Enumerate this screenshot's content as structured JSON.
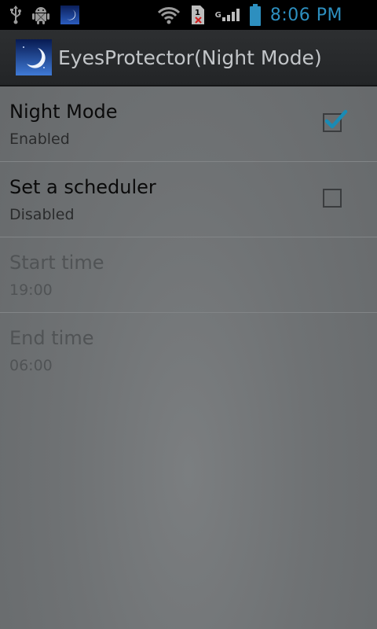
{
  "status_bar": {
    "time": "8:06 PM",
    "network_label": "G",
    "icons": [
      "usb-icon",
      "android-debug-icon",
      "night-mode-notification-icon",
      "wifi-icon",
      "sim-missing-icon",
      "signal-icon",
      "battery-icon"
    ],
    "time_color": "#2d8fbf"
  },
  "action_bar": {
    "title": "EyesProtector(Night Mode)",
    "icon": "moon-icon"
  },
  "preferences": [
    {
      "title": "Night Mode",
      "summary": "Enabled",
      "checked": true,
      "enabled": true
    },
    {
      "title": "Set a scheduler",
      "summary": "Disabled",
      "checked": false,
      "enabled": true
    },
    {
      "title": "Start time",
      "summary": "19:00",
      "enabled": false
    },
    {
      "title": "End time",
      "summary": "06:00",
      "enabled": false
    }
  ],
  "colors": {
    "accent": "#33b5e5",
    "overlay": "#6b6e70"
  }
}
